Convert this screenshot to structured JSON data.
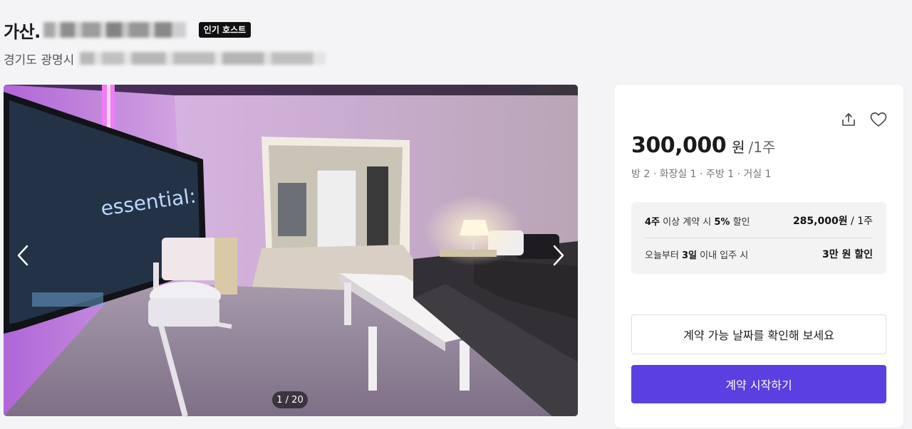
{
  "listing": {
    "title_prefix": "가산.",
    "badge": "인기 호스트",
    "address_prefix": "경기도 광명시"
  },
  "gallery": {
    "counter": "1 / 20",
    "prev_icon": "chevron-left-icon",
    "next_icon": "chevron-right-icon",
    "tv_text": "essential:"
  },
  "pricing": {
    "price": "300,000",
    "currency": "원",
    "period": "/1주",
    "rooms": "방 2 · 화장실 1 · 주방 1 · 거실 1",
    "discounts": [
      {
        "bold1": "4주",
        "text1": " 이상 계약 시 ",
        "bold2": "5%",
        "text2": " 할인",
        "value": "285,000원",
        "unit": " / 1주"
      },
      {
        "text1": "오늘부터 ",
        "bold1": "3일",
        "text2": " 이내 입주 시",
        "value": "3만 원 할인"
      }
    ],
    "check_dates_label": "계약 가능 날짜를 확인해 보세요",
    "start_label": "계약 시작하기"
  },
  "colors": {
    "accent": "#5b3fe0",
    "badge_bg": "#111111"
  }
}
